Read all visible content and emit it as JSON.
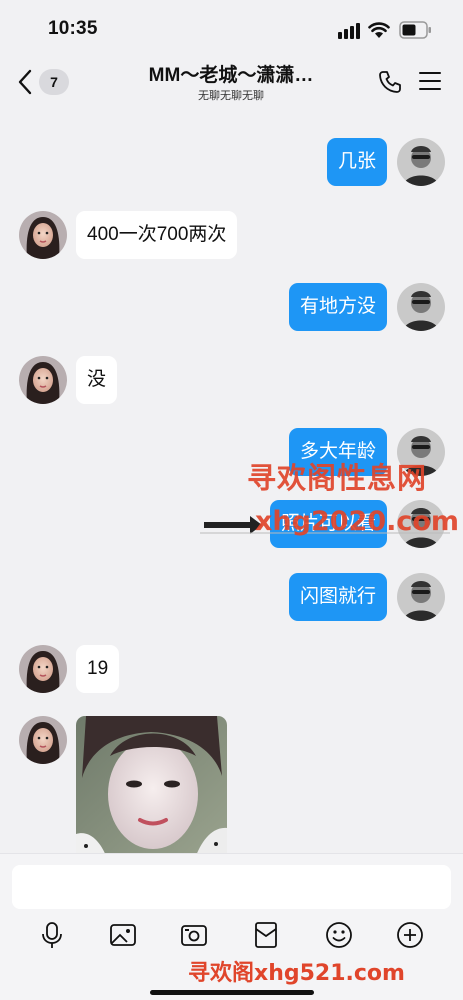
{
  "status_bar": {
    "time": "10:35"
  },
  "header": {
    "back_icon": "chevron-left-icon",
    "unread_count": "7",
    "title": "MM～老城～潇潇…",
    "subtitle": "无聊无聊无聊",
    "phone_icon": "phone-icon",
    "menu_icon": "menu-icon"
  },
  "messages": [
    {
      "direction": "out",
      "text": "几张"
    },
    {
      "direction": "in",
      "text": "400一次700两次"
    },
    {
      "direction": "out",
      "text": "有地方没"
    },
    {
      "direction": "in",
      "text": "没"
    },
    {
      "direction": "out",
      "text": "多大年龄"
    },
    {
      "direction": "out",
      "text": "照片可以看"
    },
    {
      "direction": "out",
      "text": "闪图就行"
    },
    {
      "direction": "in",
      "text": "19"
    },
    {
      "direction": "in",
      "type": "image"
    }
  ],
  "watermarks": {
    "main": "寻欢阁性息网",
    "url": "xhg2020.com",
    "bottom": "寻欢阁xhg521.com"
  },
  "input": {
    "value": "",
    "placeholder": ""
  },
  "toolbar": [
    {
      "icon": "microphone-icon"
    },
    {
      "icon": "image-icon"
    },
    {
      "icon": "camera-icon"
    },
    {
      "icon": "red-packet-icon"
    },
    {
      "icon": "emoji-icon"
    },
    {
      "icon": "plus-icon"
    }
  ],
  "colors": {
    "outgoing_bubble": "#1e96f5",
    "incoming_bubble": "#ffffff",
    "background": "#f1f1f3",
    "watermark": "#e0452b"
  }
}
